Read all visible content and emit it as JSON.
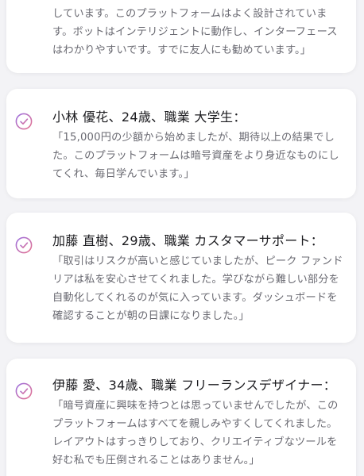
{
  "colors": {
    "check_gradient_start": "#9b6fe0",
    "check_gradient_end": "#e6738f",
    "name_text": "#1b1b1f",
    "quote_text": "#6a6a72"
  },
  "testimonials": [
    {
      "name": "",
      "quote": "しています。このプラットフォームはよく設計されています。ボットはインテリジェントに動作し、インターフェースはわかりやすいです。すでに友人にも勧めています。」"
    },
    {
      "name": "小林 優花、24歳、職業 大学生：",
      "quote": "「15,000円の少額から始めましたが、期待以上の結果でした。このプラットフォームは暗号資産をより身近なものにしてくれ、毎日学んでいます。」"
    },
    {
      "name": "加藤 直樹、29歳、職業 カスタマーサポート：",
      "quote": "「取引はリスクが高いと感じていましたが、ピーク ファンドリアは私を安心させてくれました。学びながら難しい部分を自動化してくれるのが気に入っています。ダッシュボードを確認することが朝の日課になりました。」"
    },
    {
      "name": "伊藤 愛、34歳、職業 フリーランスデザイナー：",
      "quote": "「暗号資産に興味を持つとは思っていませんでしたが、このプラットフォームはすべてを親しみやすくしてくれました。レイアウトはすっきりしており、クリエイティブなツールを好む私でも圧倒されることはありません。」"
    }
  ]
}
